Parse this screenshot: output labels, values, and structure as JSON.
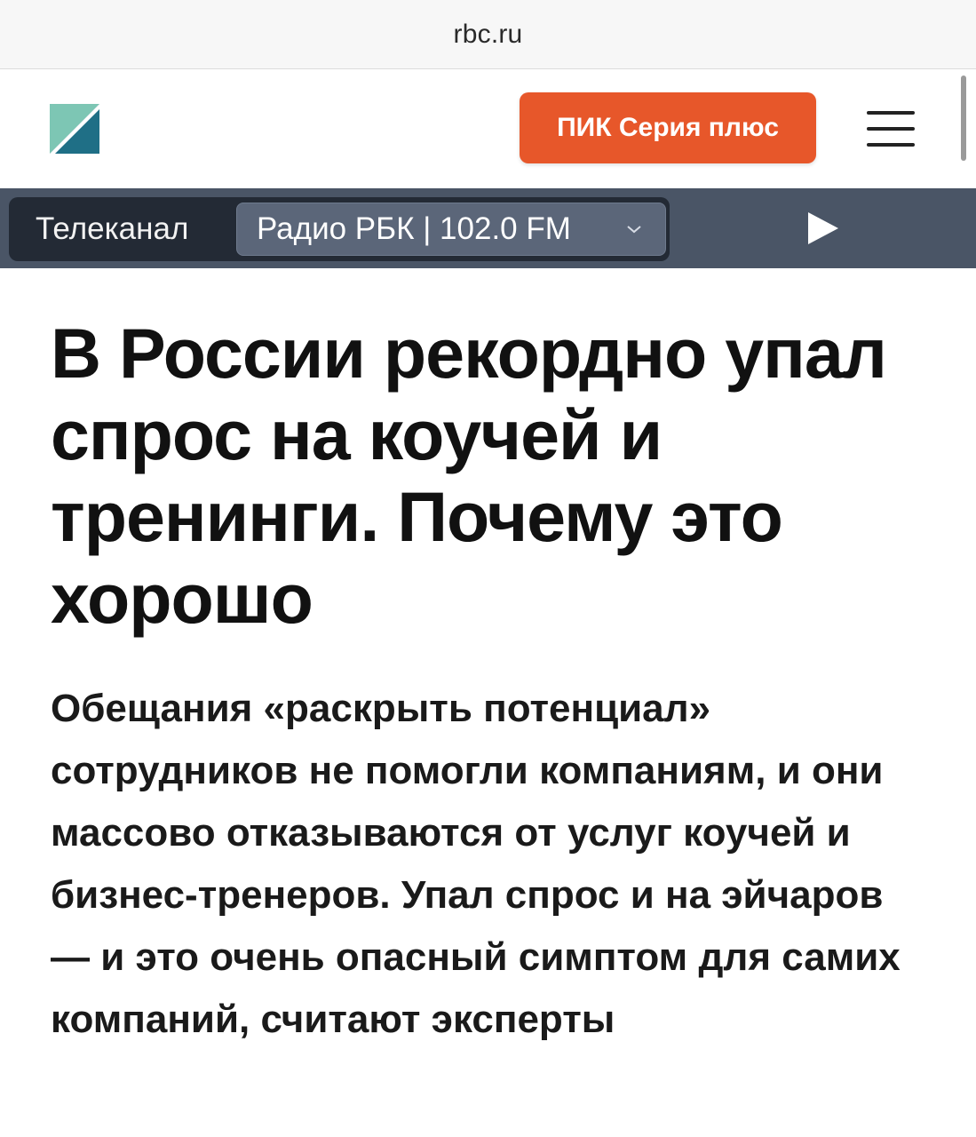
{
  "browser": {
    "url": "rbc.ru"
  },
  "header": {
    "logo_icon": "rbc-logo-icon",
    "cta_label": "ПИК Серия плюс",
    "menu_icon": "hamburger-menu-icon",
    "accent_color": "#e7572a"
  },
  "radio_bar": {
    "tab_tv": "Телеканал",
    "tab_radio": "Радио РБК | 102.0 FM",
    "dropdown_icon": "chevron-down-icon",
    "play_icon": "play-icon"
  },
  "article": {
    "title": "В России рекордно упал спрос на коучей и тренинги. Почему это хорошо",
    "lead": "Обещания «раскрыть потенциал» сотрудников не помогли компаниям, и они массово отказываются от услуг коучей и бизнес-тренеров. Упал спрос и на эйчаров — и это очень опасный симптом для самих компаний, считают эксперты"
  }
}
